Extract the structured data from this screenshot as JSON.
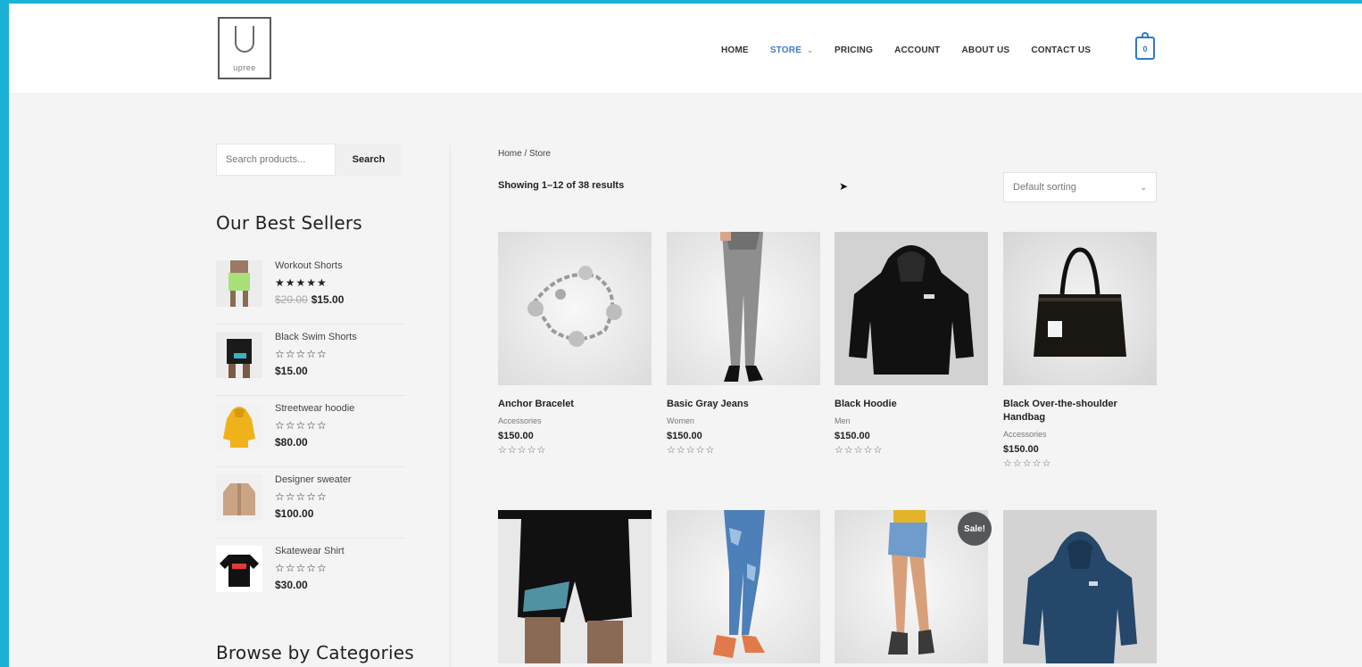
{
  "logo": {
    "text": "upree"
  },
  "nav": {
    "items": [
      "HOME",
      "STORE",
      "PRICING",
      "ACCOUNT",
      "ABOUT US",
      "CONTACT US"
    ],
    "active": "STORE",
    "store_caret": "⌄"
  },
  "cart": {
    "count": "0"
  },
  "sidebar": {
    "search": {
      "placeholder": "Search products...",
      "button": "Search"
    },
    "best_sellers_title": "Our Best Sellers",
    "best_sellers": [
      {
        "name": "Workout Shorts",
        "stars": "★★★★★",
        "old_price": "$20.00",
        "price": "$15.00"
      },
      {
        "name": "Black Swim Shorts",
        "stars": "☆☆☆☆☆",
        "price": "$15.00"
      },
      {
        "name": "Streetwear hoodie",
        "stars": "☆☆☆☆☆",
        "price": "$80.00"
      },
      {
        "name": "Designer sweater",
        "stars": "☆☆☆☆☆",
        "price": "$100.00"
      },
      {
        "name": "Skatewear Shirt",
        "stars": "☆☆☆☆☆",
        "price": "$30.00"
      }
    ],
    "categories_title": "Browse by Categories"
  },
  "main": {
    "breadcrumb": "Home / Store",
    "result_count": "Showing 1–12 of 38 results",
    "sort_label": "Default sorting",
    "products": [
      {
        "name": "Anchor Bracelet",
        "category": "Accessories",
        "price": "$150.00",
        "stars": "☆☆☆☆☆"
      },
      {
        "name": "Basic Gray Jeans",
        "category": "Women",
        "price": "$150.00",
        "stars": "☆☆☆☆☆"
      },
      {
        "name": "Black Hoodie",
        "category": "Men",
        "price": "$150.00",
        "stars": "☆☆☆☆☆"
      },
      {
        "name": "Black Over-the-shoulder Handbag",
        "category": "Accessories",
        "price": "$150.00",
        "stars": "☆☆☆☆☆"
      }
    ],
    "sale_badge": "Sale!"
  }
}
